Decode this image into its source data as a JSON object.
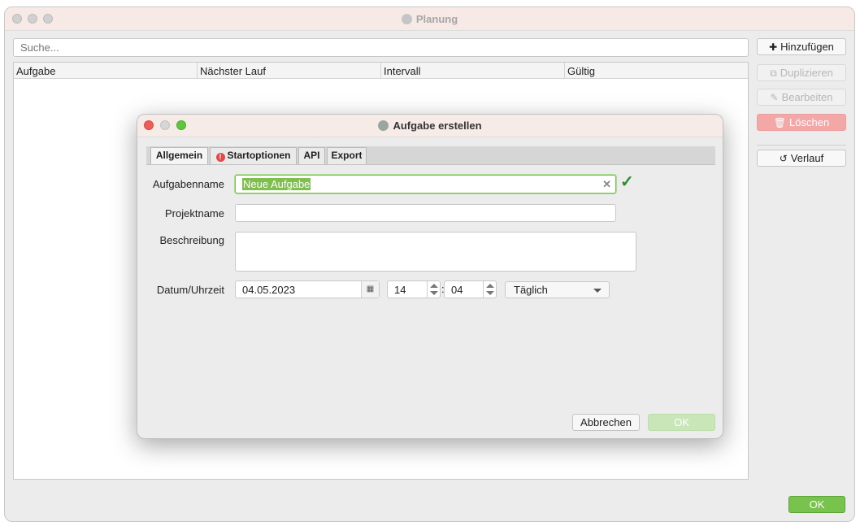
{
  "main_window": {
    "title": "Planung",
    "search_placeholder": "Suche...",
    "columns": [
      "Aufgabe",
      "Nächster Lauf",
      "Intervall",
      "Gültig"
    ],
    "side_buttons": {
      "add": "Hinzufügen",
      "duplicate": "Duplizieren",
      "edit": "Bearbeiten",
      "delete": "Löschen",
      "history": "Verlauf"
    },
    "ok_label": "OK"
  },
  "dialog": {
    "title": "Aufgabe erstellen",
    "tabs": [
      "Allgemein",
      "Startoptionen",
      "API",
      "Export"
    ],
    "labels": {
      "task_name": "Aufgabenname",
      "project_name": "Projektname",
      "description": "Beschreibung",
      "datetime": "Datum/Uhrzeit"
    },
    "values": {
      "task_name": "Neue Aufgabe",
      "project_name": "",
      "description": "",
      "date": "04.05.2023",
      "hour": "14",
      "minute": "04",
      "interval": "Täglich"
    },
    "time_separator": ":",
    "buttons": {
      "cancel": "Abbrechen",
      "ok": "OK"
    }
  },
  "colors": {
    "accent_green": "#77c34e",
    "delete_red": "#f3a7a7",
    "validation_green": "#2d8c2d"
  }
}
